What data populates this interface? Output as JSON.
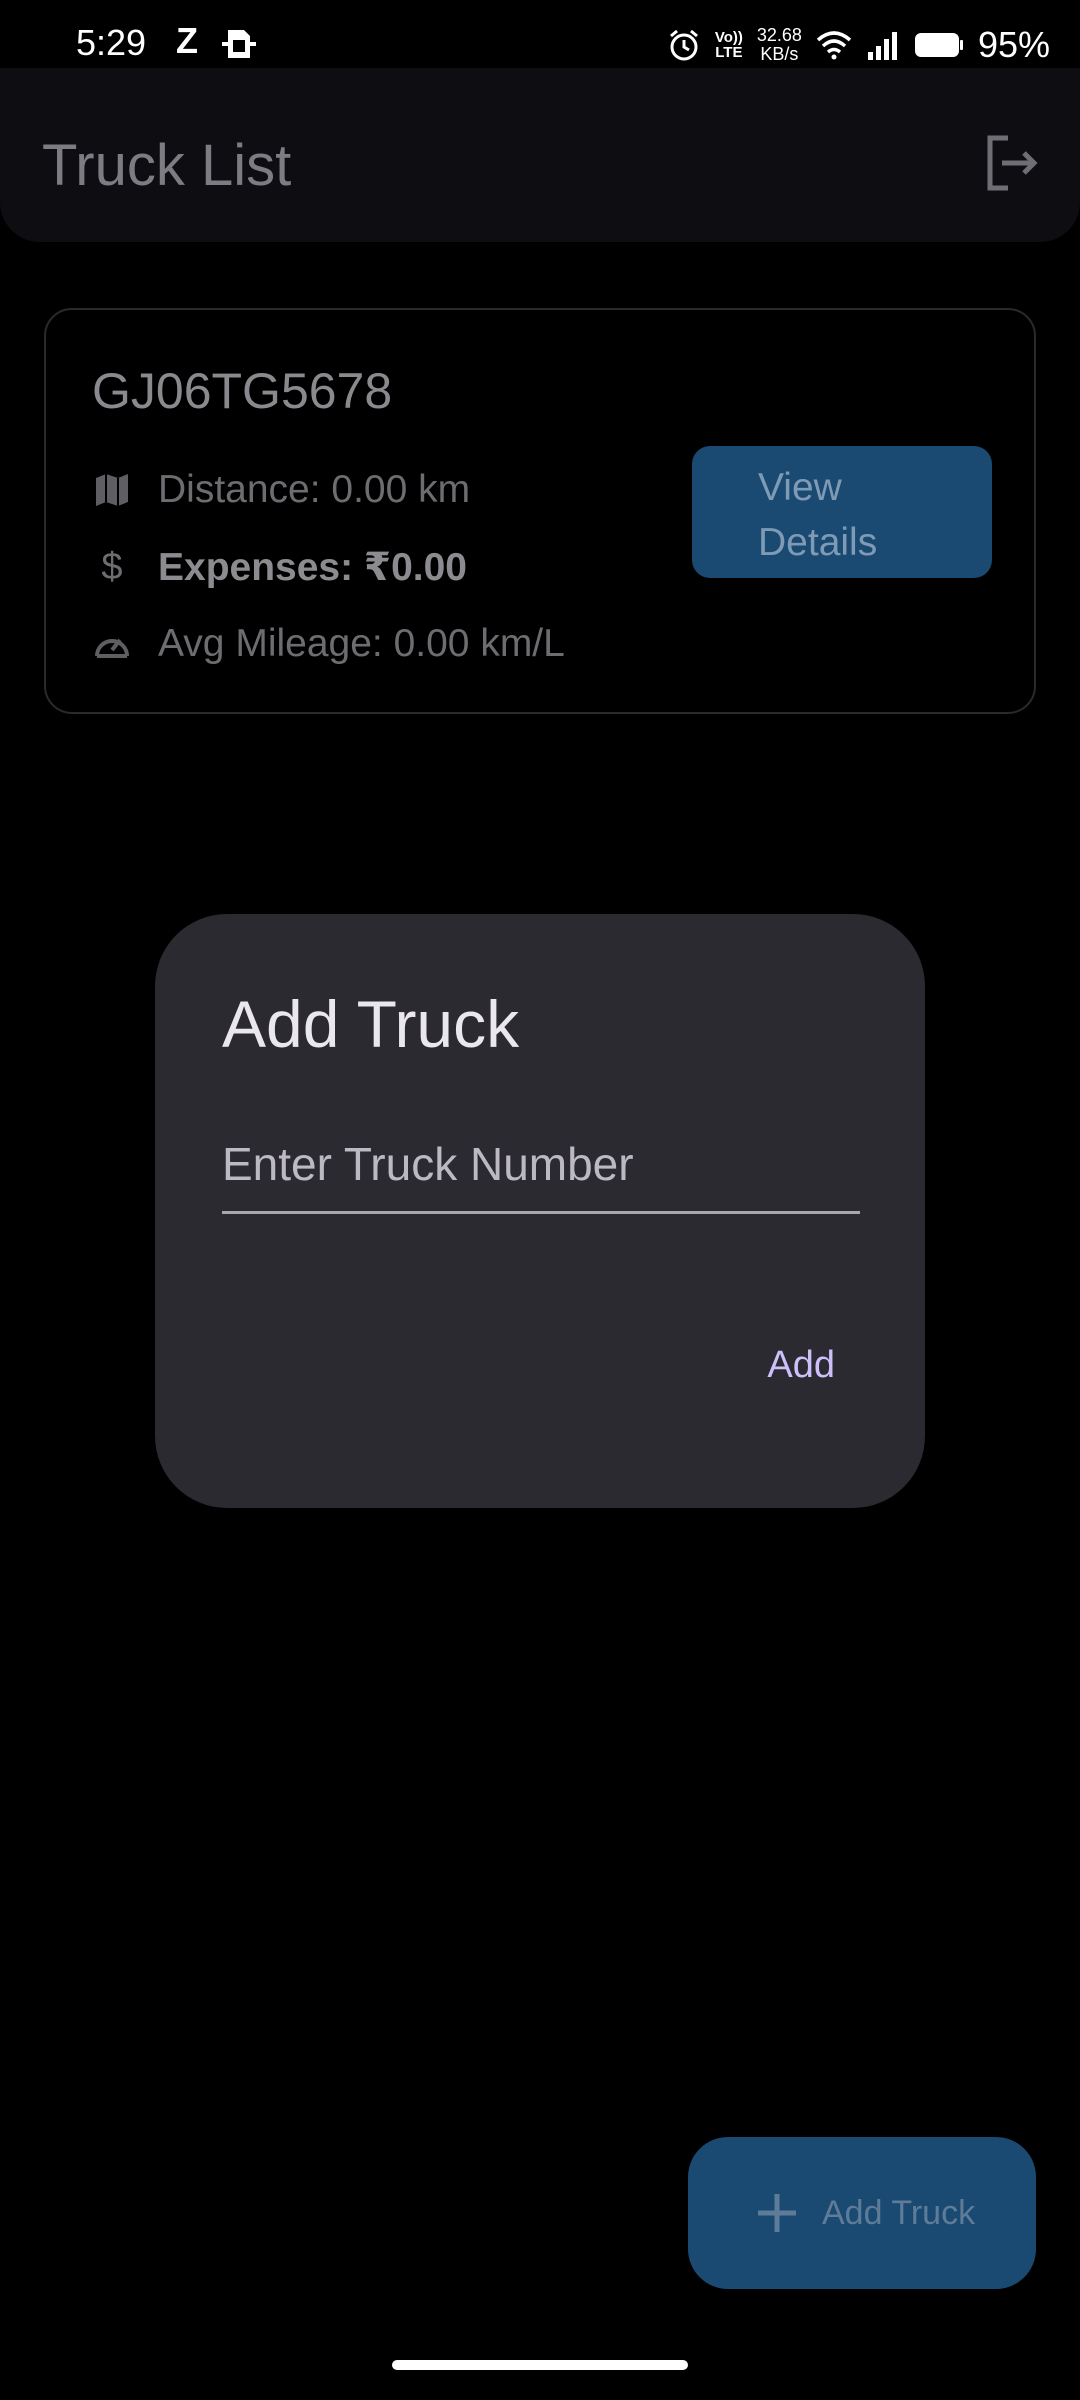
{
  "status_bar": {
    "time": "5:29",
    "z_icon": "Z",
    "net_lte_top": "Vo))",
    "net_lte_bottom": "LTE",
    "net_speed_value": "32.68",
    "net_speed_unit": "KB/s",
    "battery_percent": "95%",
    "icons": [
      "sim-card-icon",
      "alarm-icon",
      "wifi-icon",
      "signal-icon",
      "battery-icon"
    ]
  },
  "app_bar": {
    "title": "Truck List",
    "logout_icon": "logout-icon"
  },
  "trucks": [
    {
      "number": "GJ06TG5678",
      "distance": "Distance: 0.00 km",
      "expenses": "Expenses: ₹0.00",
      "mileage": "Avg Mileage: 0.00 km/L",
      "view_details_line1": "View",
      "view_details_line2": "Details"
    }
  ],
  "dialog": {
    "title": "Add Truck",
    "input_placeholder": "Enter Truck Number",
    "input_value": "",
    "add_label": "Add"
  },
  "fab": {
    "label": "Add Truck",
    "icon": "plus-icon"
  },
  "colors": {
    "background": "#000000",
    "dialog_surface": "#2b2a30",
    "button_blue": "#1a4a72",
    "accent_purple": "#cdbff9"
  }
}
